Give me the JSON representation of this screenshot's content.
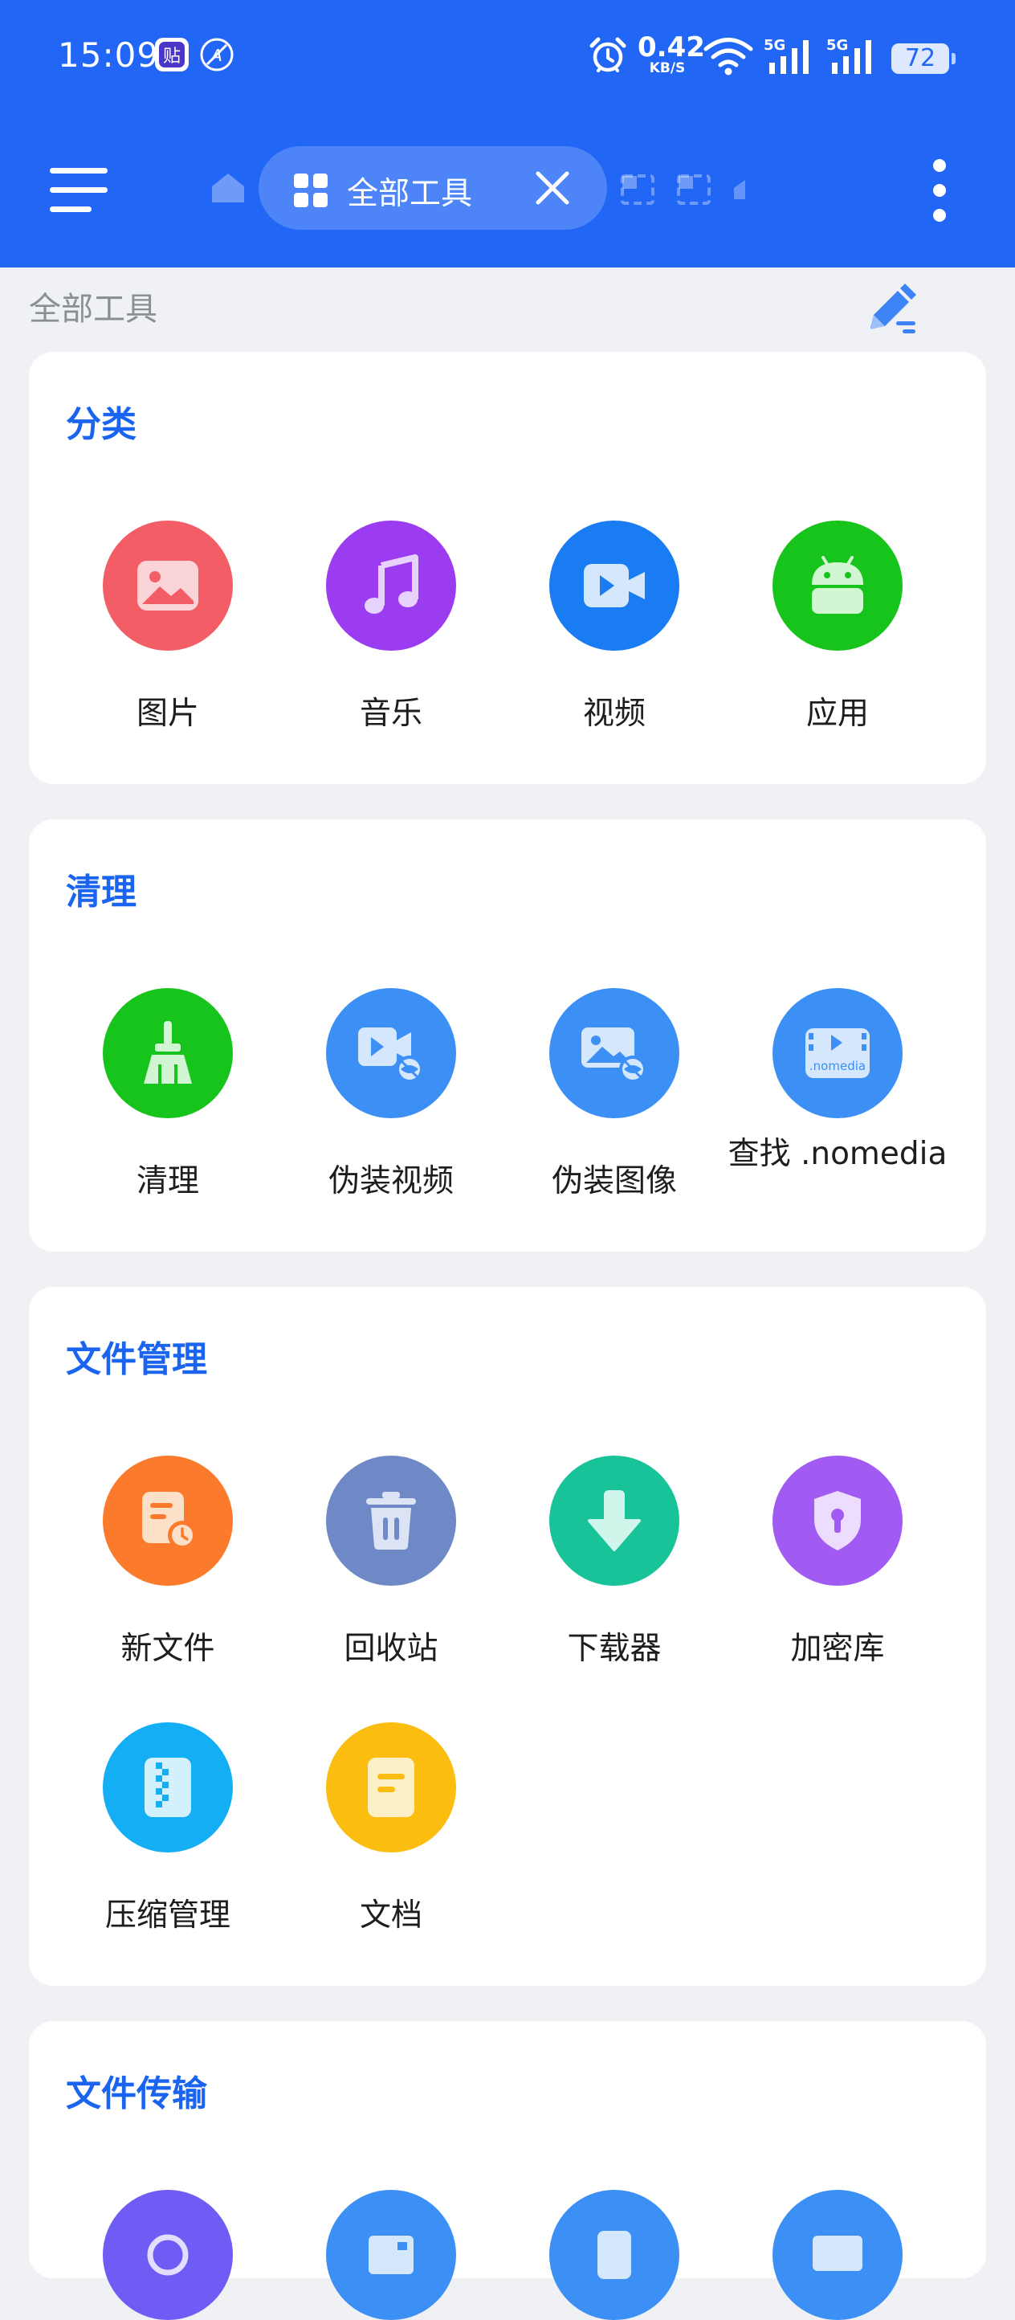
{
  "status_bar": {
    "time": "15:09",
    "net_speed_value": "0.42",
    "net_speed_unit": "KB/S",
    "signal_1_label": "5G",
    "signal_2_label": "5G",
    "battery": "72"
  },
  "header": {
    "active_tab_label": "全部工具",
    "colors": {
      "bar": "#2166f5",
      "accent": "#1a64f0"
    }
  },
  "page": {
    "title": "全部工具"
  },
  "sections": {
    "category": {
      "title": "分类",
      "items": [
        {
          "label": "图片",
          "icon": "image-icon",
          "color": "#f35d66"
        },
        {
          "label": "音乐",
          "icon": "music-icon",
          "color": "#9b3cf0"
        },
        {
          "label": "视频",
          "icon": "video-icon",
          "color": "#1a7cf2"
        },
        {
          "label": "应用",
          "icon": "android-icon",
          "color": "#17c41b"
        }
      ]
    },
    "cleanup": {
      "title": "清理",
      "items": [
        {
          "label": "清理",
          "icon": "broom-icon",
          "color": "#17c41b"
        },
        {
          "label": "伪装视频",
          "icon": "hidden-video-icon",
          "color": "#3b8ff5"
        },
        {
          "label": "伪装图像",
          "icon": "hidden-image-icon",
          "color": "#3b8ff5"
        },
        {
          "label": "查找 .nomedia",
          "icon": "nomedia-icon",
          "color": "#3b8ff5",
          "badge": ".nomedia"
        }
      ]
    },
    "file_management": {
      "title": "文件管理",
      "items": [
        {
          "label": "新文件",
          "icon": "recent-file-icon",
          "color": "#fb7a2c"
        },
        {
          "label": "回收站",
          "icon": "trash-icon",
          "color": "#6f89c7"
        },
        {
          "label": "下载器",
          "icon": "download-icon",
          "color": "#19c39a"
        },
        {
          "label": "加密库",
          "icon": "vault-lock-icon",
          "color": "#a15bf2"
        },
        {
          "label": "压缩管理",
          "icon": "archive-icon",
          "color": "#13aef4"
        },
        {
          "label": "文档",
          "icon": "document-icon",
          "color": "#fbbd0f"
        }
      ]
    },
    "file_transfer": {
      "title": "文件传输",
      "items": [
        {
          "icon": "transfer-icon-1",
          "color": "#6f5cf5"
        },
        {
          "icon": "transfer-icon-2",
          "color": "#3b8ff5"
        },
        {
          "icon": "transfer-icon-3",
          "color": "#3b8ff5"
        },
        {
          "icon": "transfer-icon-4",
          "color": "#3b8ff5"
        }
      ]
    }
  }
}
